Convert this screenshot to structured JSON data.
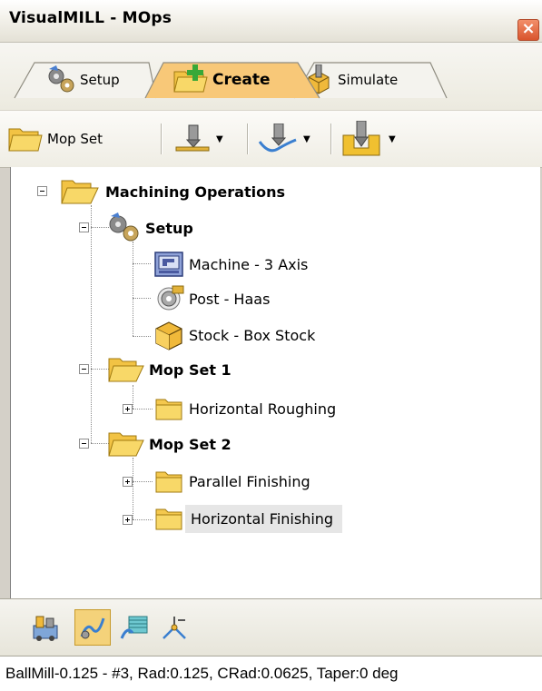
{
  "window": {
    "title": "VisualMILL - MOps",
    "close_glyph": "×"
  },
  "tabs": [
    {
      "label": "Setup",
      "icon": "gear-cogs-icon",
      "active": false
    },
    {
      "label": "Create",
      "icon": "folder-add-icon",
      "active": true
    },
    {
      "label": "Simulate",
      "icon": "simulate-block-icon",
      "active": false
    }
  ],
  "toolbar": {
    "mop_set_label": "Mop Set",
    "buttons": [
      "2-axis-milling-icon",
      "3-axis-milling-icon",
      "drilling-icon"
    ]
  },
  "tree": {
    "root": "Machining Operations",
    "setup": "Setup",
    "machine": "Machine - 3 Axis",
    "post": "Post - Haas",
    "stock": "Stock - Box Stock",
    "mopset1": "Mop Set 1",
    "mopset1_child1": "Horizontal Roughing",
    "mopset2": "Mop Set 2",
    "mopset2_child1": "Parallel Finishing",
    "mopset2_child2": "Horizontal Finishing"
  },
  "bottom_icons": [
    "tools-library-icon",
    "toolpath-icon",
    "cutting-material-icon",
    "post-process-icon"
  ],
  "status": "BallMill-0.125 - #3, Rad:0.125, CRad:0.0625, Taper:0 deg",
  "colors": {
    "active_tab": "#f8c878",
    "folder": "#f4c64a",
    "selection": "#e6e6e6"
  }
}
